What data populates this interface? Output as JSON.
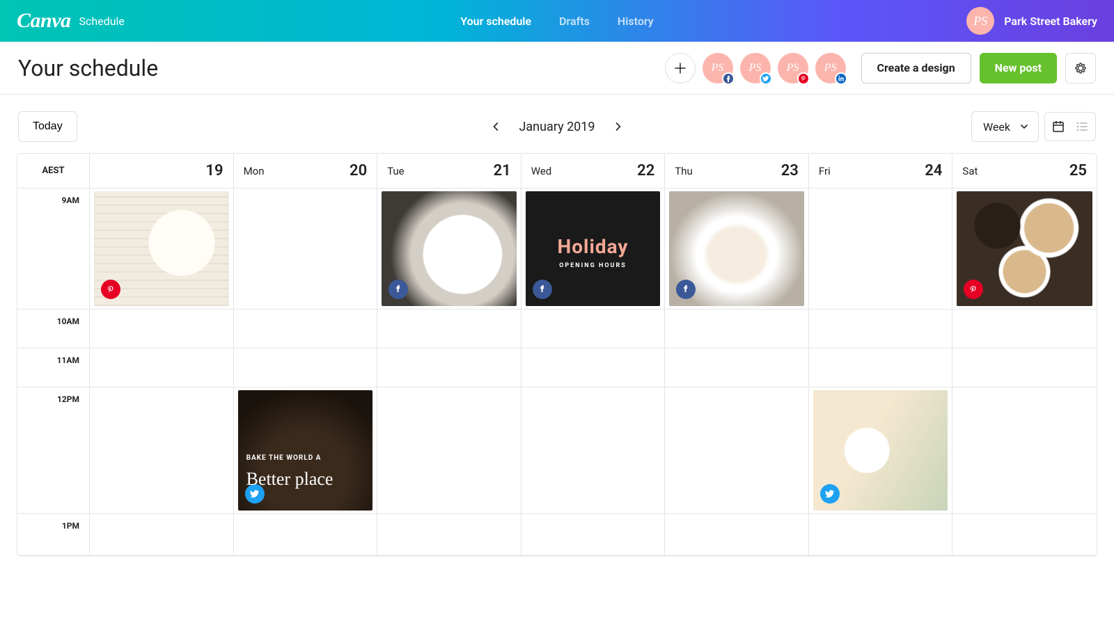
{
  "brand": {
    "logo": "Canva",
    "sub": "Schedule"
  },
  "nav": {
    "schedule": "Your schedule",
    "drafts": "Drafts",
    "history": "History"
  },
  "user": {
    "initials": "PS",
    "name": "Park Street Bakery"
  },
  "page": {
    "title": "Your schedule"
  },
  "accounts": {
    "initials": "PS"
  },
  "buttons": {
    "create": "Create a design",
    "newpost": "New post",
    "today": "Today"
  },
  "monthnav": {
    "label": "January 2019"
  },
  "view": {
    "selected": "Week"
  },
  "calendar": {
    "tz": "AEST",
    "days": [
      {
        "dow": "",
        "num": "19"
      },
      {
        "dow": "Mon",
        "num": "20"
      },
      {
        "dow": "Tue",
        "num": "21"
      },
      {
        "dow": "Wed",
        "num": "22"
      },
      {
        "dow": "Thu",
        "num": "23"
      },
      {
        "dow": "Fri",
        "num": "24"
      },
      {
        "dow": "Sat",
        "num": "25"
      }
    ],
    "times": {
      "t9": "9AM",
      "t10": "10AM",
      "t11": "11AM",
      "t12": "12PM",
      "t13": "1PM"
    }
  },
  "posts": {
    "holiday": {
      "title": "Holiday",
      "sub": "OPENING HOURS"
    },
    "bread": {
      "tag": "BAKE THE WORLD A",
      "script": "Better place"
    }
  }
}
